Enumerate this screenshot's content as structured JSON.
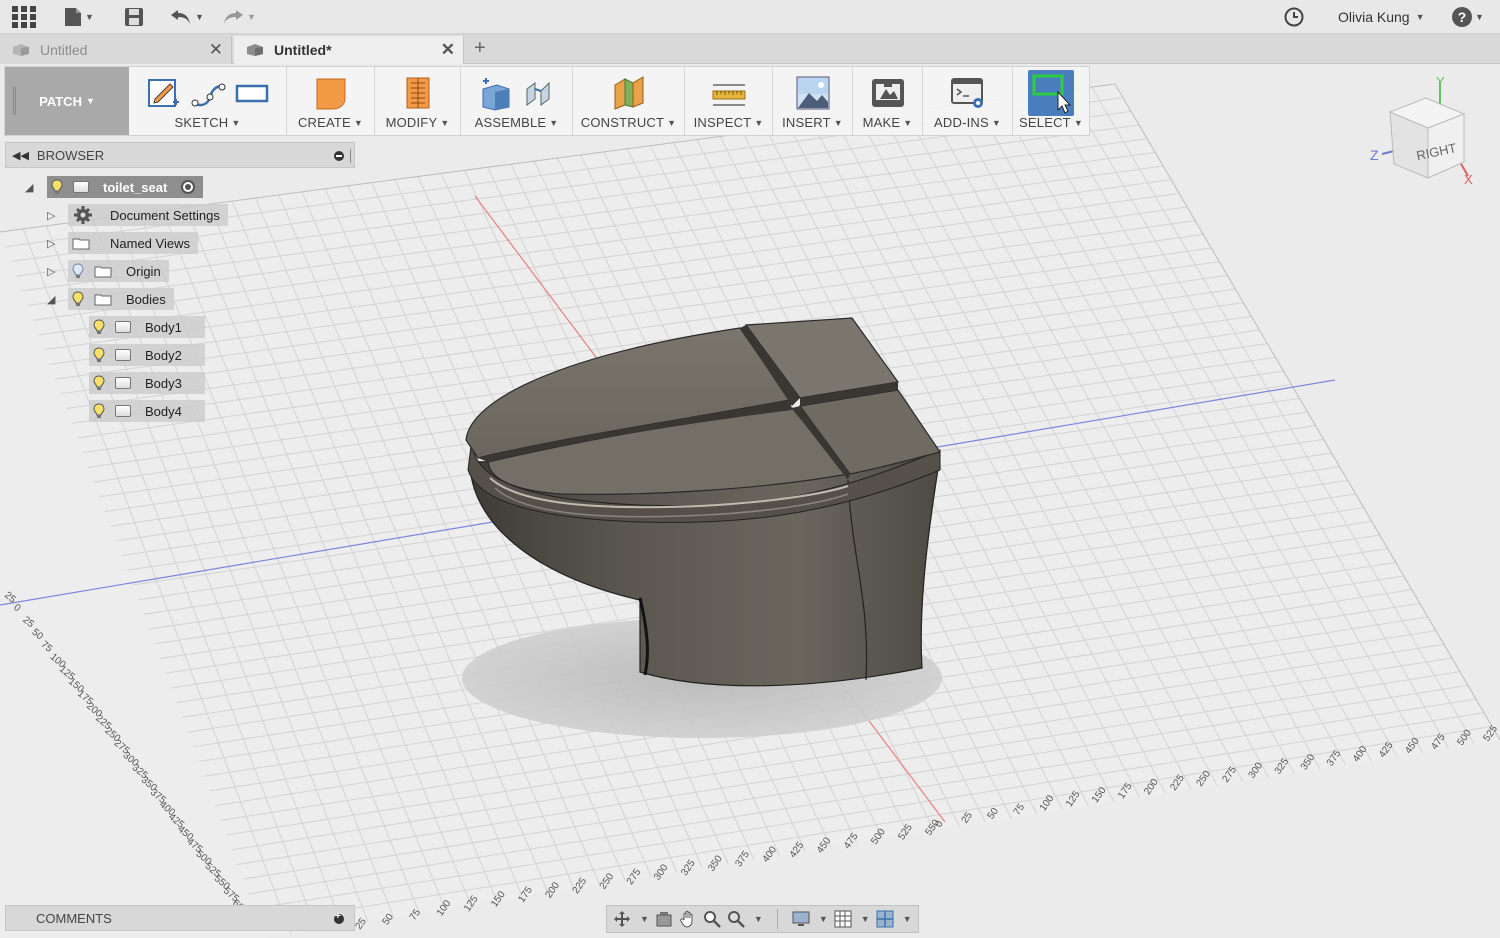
{
  "topbar": {
    "user_name": "Olivia Kung",
    "help_label": "?"
  },
  "tabs": [
    {
      "label": "Untitled",
      "active": false
    },
    {
      "label": "Untitled*",
      "active": true
    }
  ],
  "toolbar": {
    "workspace": "PATCH",
    "groups": {
      "sketch": "SKETCH",
      "create": "CREATE",
      "modify": "MODIFY",
      "assemble": "ASSEMBLE",
      "construct": "CONSTRUCT",
      "inspect": "INSPECT",
      "insert": "INSERT",
      "make": "MAKE",
      "addins": "ADD-INS",
      "select": "SELECT"
    }
  },
  "browser": {
    "title": "BROWSER",
    "root": "toilet_seat",
    "items": {
      "document_settings": "Document Settings",
      "named_views": "Named Views",
      "origin": "Origin",
      "bodies": "Bodies"
    },
    "bodies": [
      "Body1",
      "Body2",
      "Body3",
      "Body4"
    ]
  },
  "viewcube": {
    "face": "RIGHT",
    "axis_x": "X",
    "axis_y": "Y",
    "axis_z": "Z"
  },
  "comments": {
    "title": "COMMENTS"
  },
  "grid_labels": {
    "left": [
      "25",
      "0",
      "25",
      "50",
      "75",
      "100",
      "125",
      "150",
      "175",
      "200",
      "225",
      "250",
      "275",
      "300",
      "325",
      "350",
      "375",
      "400",
      "425",
      "450",
      "475",
      "500",
      "525",
      "550",
      "575",
      "600"
    ],
    "bottom": [
      "0",
      "25",
      "50",
      "75",
      "100",
      "125",
      "150",
      "175",
      "200",
      "225",
      "250",
      "275",
      "300",
      "325",
      "350",
      "375",
      "400",
      "425",
      "450",
      "475",
      "500",
      "525"
    ],
    "bottom_left": [
      "25",
      "50",
      "75",
      "100",
      "125",
      "150",
      "175",
      "200",
      "225",
      "250",
      "275",
      "300",
      "325",
      "350",
      "375",
      "400",
      "425",
      "450",
      "475",
      "500",
      "525",
      "550"
    ]
  },
  "colors": {
    "model": "#67625a",
    "select_blue": "#4a7dbd",
    "x_axis": "#e06060",
    "z_axis": "#5f6fd9"
  }
}
